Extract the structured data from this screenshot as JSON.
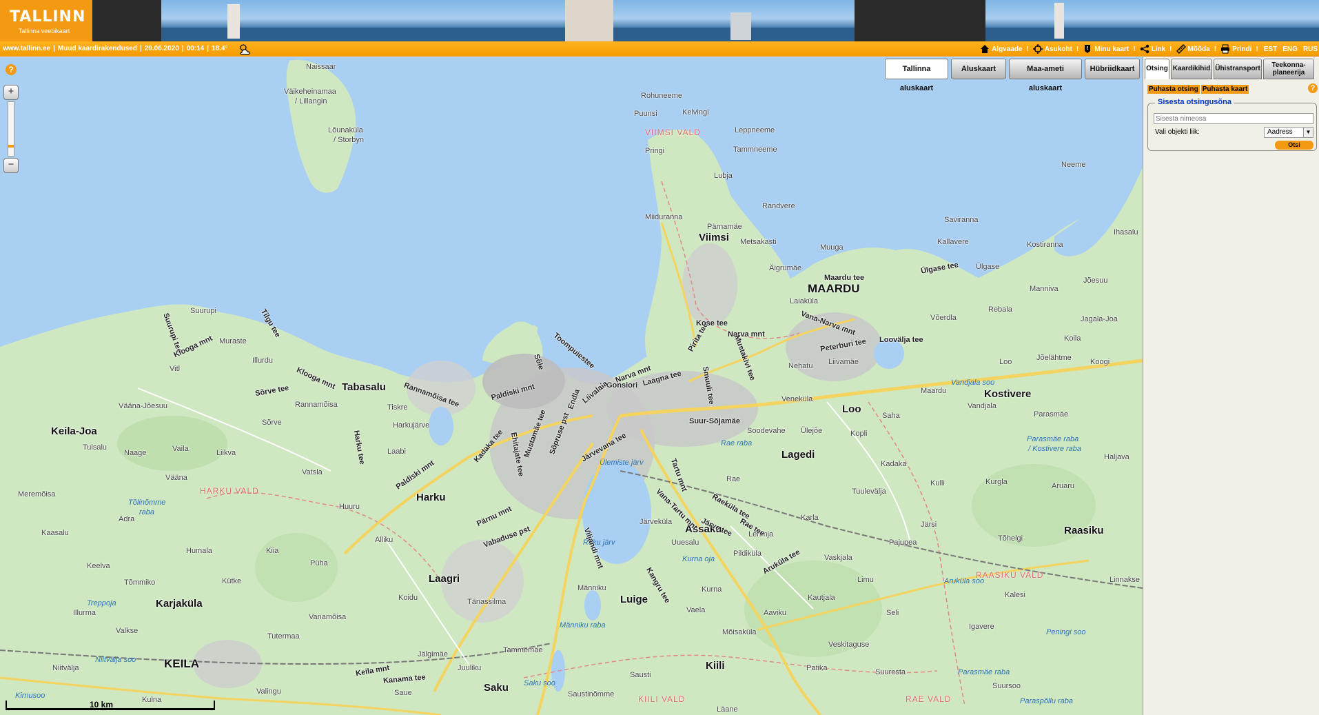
{
  "header": {
    "logo_text": "TALLINN",
    "logo_subtitle": "Tallinna veebikaart"
  },
  "statusbar": {
    "site": "www.tallinn.ee",
    "other_apps": "Muud kaardirakendused",
    "date": "29.06.2020",
    "time": "00:14",
    "temperature": "18.4°",
    "weather_icon": "partly-cloudy-night-icon"
  },
  "toolbar": {
    "overview": "Algvaade",
    "locate": "Asukoht",
    "my_map": "Minu kaart",
    "link": "Link",
    "measure": "Mõõda",
    "print": "Prindi",
    "languages": [
      "EST",
      "ENG",
      "RUS"
    ]
  },
  "map_layers": [
    {
      "label": "Tallinna aluskaart",
      "active": true
    },
    {
      "label": "Aluskaart",
      "active": false
    },
    {
      "label": "Maa-ameti aluskaart",
      "active": false
    },
    {
      "label": "Hübriidkaart",
      "active": false
    }
  ],
  "scale": {
    "label": "10 km"
  },
  "panel": {
    "tabs": [
      {
        "label": "Otsing",
        "active": true
      },
      {
        "label": "Kaardikihid",
        "active": false
      },
      {
        "label": "Ühistransport",
        "active": false
      },
      {
        "label": "Teekonna-planeerija",
        "line1": "Teekonna-",
        "line2": "planeerija",
        "active": false
      }
    ],
    "clear_search": "Puhasta otsing",
    "clear_map": "Puhasta kaart",
    "search_legend": "Sisesta otsingusõna",
    "search_placeholder": "Sisesta nimeosa",
    "type_label": "Vali objekti liik:",
    "type_value": "Aadress",
    "search_button": "Otsi"
  },
  "places": {
    "naissaar": "Naissaar",
    "vaikeheinamaa": "Väikeheinamaa",
    "lillangin": "/ Lillangin",
    "lounakula": "Lõunaküla",
    "storbyn": "/ Storbyn",
    "rohuneeme": "Rohuneeme",
    "puunsi": "Puunsi",
    "kelvingi": "Kelvingi",
    "viimsi_vald": "VIIMSI VALD",
    "leppneeme": "Leppneeme",
    "tammneeme": "Tammneeme",
    "lubja": "Lubja",
    "randvere": "Randvere",
    "miiduranna": "Miiduranna",
    "pringi": "Pringi",
    "viimsi": "Viimsi",
    "pamamae": "Pärnamäe",
    "metsakasti": "Metsakasti",
    "muuga": "Muuga",
    "saviranna": "Saviranna",
    "kallavere": "Kallavere",
    "kostiranna": "Kostiranna",
    "neeme": "Neeme",
    "ihasalu": "Ihasalu",
    "maardu": "MAARDU",
    "aigrumae": "Äigrumäe",
    "laiakula": "Laiaküla",
    "ulgase": "Ülgase",
    "manniva": "Manniva",
    "joesuu": "Jõesuu",
    "rebala": "Rebala",
    "voerdla": "Võerdla",
    "jagala_joa": "Jagala-Joa",
    "koila": "Koila",
    "koogi": "Koogi",
    "loo": "Loo",
    "kostivere": "Kostivere",
    "joelahtme": "Jõelähtme",
    "vandjala_soo": "Vandjala soo",
    "vandjala": "Vandjala",
    "maardu_small": "Maardu",
    "parasmae": "Parasmäe",
    "parasmae_raba": "Parasmäe raba",
    "kostivere_raba": "/ Kostivere raba",
    "haljava": "Haljava",
    "nehatu": "Nehatu",
    "liivamae": "Liivamäe",
    "venekula": "Veneküla",
    "saha": "Saha",
    "kopli": "Kopli",
    "soodevahe": "Soodevahe",
    "ulejoe": "Ülejõe",
    "lagedi": "Lagedi",
    "kadaka": "Kadaka",
    "tuulevalja": "Tuulevälja",
    "kulli": "Kulli",
    "kurgla": "Kurgla",
    "aruaru": "Aruaru",
    "jarsi": "Järsi",
    "tohelgi": "Tõhelgi",
    "raasiku": "Raasiku",
    "raasiku_vald": "RAASIKU VALD",
    "linnakse": "Linnakse",
    "naissaar2": "",
    "suurupi": "Suurupi",
    "muraste": "Muraste",
    "klooga_mnt": "Klooga mnt",
    "illurdu": "Illurdu",
    "vitl": "Vitl",
    "tabasalu": "Tabasalu",
    "rannamoisa": "Rannamõisa",
    "tiskre": "Tiskre",
    "harkujarve": "Harkujärve",
    "vaana_joesuu": "Vääna-Jõesuu",
    "keila_joa": "Keila-Joa",
    "tuisalu": "Tuisalu",
    "naage": "Naage",
    "vaila": "Vaila",
    "liikva": "Liikva",
    "laabi": "Laabi",
    "vatsla": "Vatsla",
    "harku_vald": "HARKU VALD",
    "meremoisa": "Meremõisa",
    "vaana": "Vääna",
    "tolinomme": "Tõlinõmme",
    "raba": "raba",
    "adra": "Adra",
    "huuru": "Huuru",
    "harku": "Harku",
    "kaasalu": "Kaasalu",
    "humala": "Humala",
    "alliku": "Alliku",
    "kiia": "Kiia",
    "puha": "Püha",
    "keelva": "Keelva",
    "kutke": "Kütke",
    "laagri": "Laagri",
    "tommiko": "Tõmmiko",
    "karjakula": "Karjaküla",
    "koidu": "Koidu",
    "treppoja": "Treppoja",
    "illurma": "Illurma",
    "vanamoisa": "Vanamõisa",
    "valkse": "Valkse",
    "tutermaa": "Tutermaa",
    "tanassilma": "Tänassilma",
    "niitvalja_soo": "Niitvälja soo",
    "keila": "KEILA",
    "nitvalja": "Niitvälja",
    "kirnusoo": "Kirnusoo",
    "kulna": "Kulna",
    "valingu": "Valingu",
    "saue": "Saue",
    "jalgimae": "Jälgimäe",
    "juuliku": "Juuliku",
    "tammemae": "Tammemäe",
    "saku": "Saku",
    "saku_soo": "Saku soo",
    "saustinomme": "Saustinõmme",
    "kiili_vald": "KIILI VALD",
    "laane": "Läane",
    "kiili": "Kiili",
    "sausti": "Sausti",
    "luige": "Luige",
    "manniku": "Männiku",
    "manniku_raba": "Männiku raba",
    "kurna": "Kurna",
    "vaela": "Vaela",
    "mouisakula": "Mõisaküla",
    "aaviku": "Aaviku",
    "assaku": "Assaku",
    "uuesalu": "Uuesalu",
    "kurna_oja": "Kurna oja",
    "pildikula": "Pildiküla",
    "lehmja": "Lehmja",
    "karla": "Karla",
    "rae": "Rae",
    "rae_raba": "Rae raba",
    "jarvekula": "Järveküla",
    "vaskjala": "Vaskjala",
    "pajupea": "Pajupea",
    "limu": "Limu",
    "kautjala": "Kautjala",
    "selli": "Seli",
    "arukula_soo": "Aruküla soo",
    "kalesi": "Kalesi",
    "igavere": "Igavere",
    "peningi_soo": "Peningi soo",
    "veskitaguse": "Veskitaguse",
    "patika": "Patika",
    "suuresta": "Suuresta",
    "parasmae_raba2": "Parasmäe raba",
    "suursoo": "Suursoo",
    "rae_vald": "RAE VALD",
    "paraspollu_raba": "Paraspõllu raba",
    "ulemiste_jarv": "Ülemiste järv",
    "raku_jarv": "Raku järv",
    "pirita_tee": "Pirita tee",
    "narva_mnt": "Narva mnt",
    "peterburi_tee": "Peterburi tee",
    "loovalja_tee": "Loovälja tee",
    "tartu_mnt": "Tartu mnt",
    "viljandi_mnt": "Viljandi mnt",
    "parnu_mnt": "Pärnu mnt",
    "paldiski_mnt": "Paldiski mnt",
    "laagna_tee": "Laagna tee",
    "kose_tee": "Kose tee",
    "vabaduse_pst": "Vabaduse pst",
    "jarvevana_tee": "Järvevana tee",
    "suur_sojamae": "Suur-Sõjamäe",
    "keila_mnt": "Keila mnt",
    "kanama_tee": "Kanama tee",
    "vana_tartu_mnt": "Vana-Tartu mnt",
    "kangru_tee": "Kangru tee",
    "raekula_tee": "Raeküla tee",
    "jarve_tee": "Järve tee",
    "rae_tee": "Rae tee",
    "arukula_tee": "Aruküla tee",
    "vana_narva_mnt": "Vana-Narva mnt",
    "maardu_tee": "Maardu tee",
    "ulgase_tee": "Ülgase tee",
    "harku_tee": "Harku tee",
    "sorve_tee": "Sõrve tee",
    "sorve": "Sõrve",
    "tilgu_tee": "Tilgu tee",
    "suurupi_tee": "Suurupi tee",
    "rannamoisa_tee": "Rannamõisa tee",
    "endla": "Endla",
    "gonsiori": "Gonsiori",
    "toompuiestee": "Toompuiestee",
    "sole": "Sõle",
    "liivalaia": "Liivalaia",
    "kadaka_tee": "Kadaka tee",
    "mustamae_tee": "Mustamäe tee",
    "sopruse_pst": "Sõpruse pst",
    "ehitajate_tee": "Ehitajate tee",
    "smuuli_tee": "Smuuli tee",
    "mustakivi_tee": "Mustakivi tee"
  }
}
